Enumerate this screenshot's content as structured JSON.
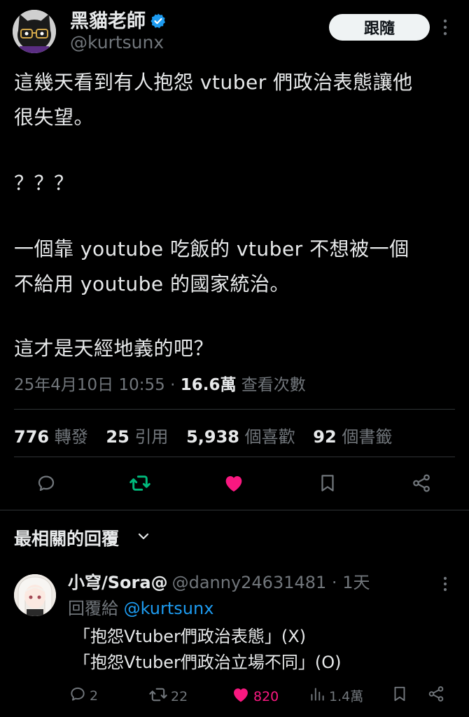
{
  "author": {
    "display_name": "黑貓老師",
    "handle": "@kurtsunx",
    "avatar_icon": "black-cat-glasses-avatar",
    "verified_icon": "verified-badge-icon"
  },
  "header": {
    "follow_label": "跟隨",
    "more_icon": "more-vertical-icon"
  },
  "tweet": {
    "lines": [
      "這幾天看到有人抱怨 vtuber 們政治表態讓他",
      "很失望。",
      "？？？",
      "一個靠 youtube 吃飯的 vtuber 不想被一個",
      "不給用 youtube 的國家統治。",
      "這才是天經地義的吧？"
    ],
    "timestamp": "25年4月10日 10:55 · ",
    "views_count": "16.6萬",
    "views_label": " 查看次數"
  },
  "stats": {
    "retweets": "776",
    "retweets_label": "轉發",
    "quotes": "25",
    "quotes_label": "引用",
    "likes": "5,938",
    "likes_label": "個喜歡",
    "bookmarks": "92",
    "bookmarks_label": "個書籤"
  },
  "actions": [
    "reply-icon",
    "retweet-icon",
    "like-icon",
    "bookmark-icon",
    "share-icon"
  ],
  "colors": {
    "retweet": "#00ba7c",
    "like": "#f91880",
    "link": "#1d9bf0",
    "muted": "#71767b"
  },
  "replies_section": {
    "title": "最相關的回覆"
  },
  "reply": {
    "display_name": "小穹/Sora@",
    "handle": "@danny24631481 · 1天",
    "reply_to_prefix": "回覆給 ",
    "reply_to_handle": "@kurtsunx",
    "lines": [
      "「抱怨Vtuber們政治表態」(X)",
      "「抱怨Vtuber們政治立場不同」(O)"
    ],
    "replies": "2",
    "retweets": "22",
    "likes": "820",
    "views": "1.4萬"
  }
}
